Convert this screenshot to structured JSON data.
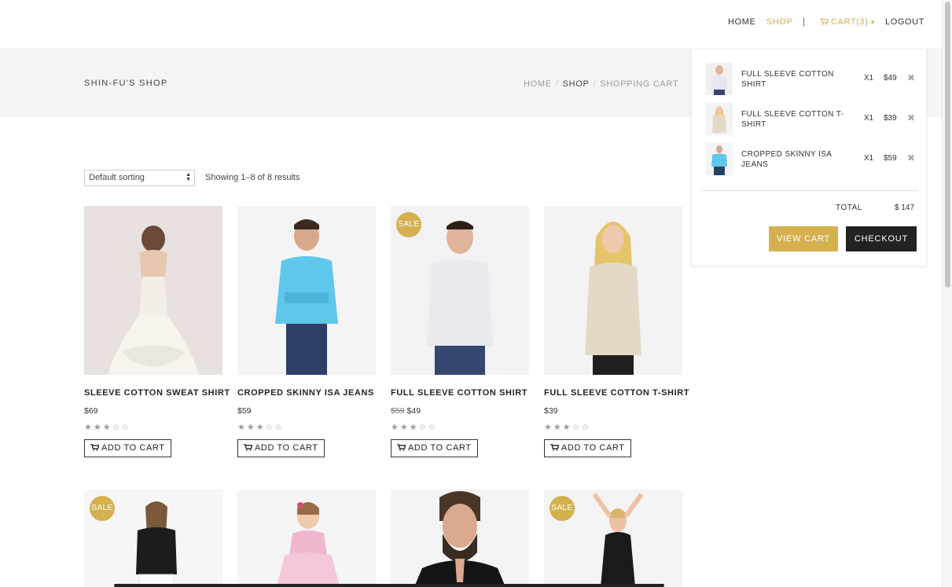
{
  "nav": {
    "home": "HOME",
    "shop": "SHOP",
    "separator": "|",
    "cart": "CART(3)",
    "cart_caret": "▾",
    "logout": "LOGOUT"
  },
  "header": {
    "shop_title": "SHIN-FU'S SHOP",
    "breadcrumb": [
      "HOME",
      "SHOP",
      "SHOPPING CART"
    ]
  },
  "toolbar": {
    "sort_value": "Default sorting",
    "results_text": "Showing 1–8 of 8 results"
  },
  "products": [
    {
      "name": "SLEEVE COTTON SWEAT SHIRT",
      "price": "$69",
      "old_price": "",
      "sale": "",
      "stars": "★★★☆☆",
      "add_label": "ADD TO CART"
    },
    {
      "name": "CROPPED SKINNY ISA JEANS",
      "price": "$59",
      "old_price": "",
      "sale": "",
      "stars": "★★★☆☆",
      "add_label": "ADD TO CART"
    },
    {
      "name": "FULL SLEEVE COTTON SHIRT",
      "price": "$49",
      "old_price": "$59",
      "sale": "SALE",
      "stars": "★★★☆☆",
      "add_label": "ADD TO CART"
    },
    {
      "name": "FULL SLEEVE COTTON T-SHIRT",
      "price": "$39",
      "old_price": "",
      "sale": "",
      "stars": "★★★☆☆",
      "add_label": "ADD TO CART"
    },
    {
      "sale": "SALE"
    },
    {
      "sale": ""
    },
    {
      "sale": ""
    },
    {
      "sale": "SALE"
    }
  ],
  "minicart": {
    "items": [
      {
        "name": "FULL SLEEVE COTTON SHIRT",
        "qty": "X1",
        "price": "$49",
        "remove": "✖"
      },
      {
        "name": "FULL SLEEVE COTTON T-SHIRT",
        "qty": "X1",
        "price": "$39",
        "remove": "✖"
      },
      {
        "name": "CROPPED SKINNY ISA JEANS",
        "qty": "X1",
        "price": "$59",
        "remove": "✖"
      }
    ],
    "total_label": "TOTAL",
    "total_value": "$ 147",
    "view_cart": "VIEW CART",
    "checkout": "CHECKOUT"
  },
  "colors": {
    "accent": "#d4b04f",
    "dark": "#222222",
    "titlebar_bg": "#f5f5f5"
  }
}
